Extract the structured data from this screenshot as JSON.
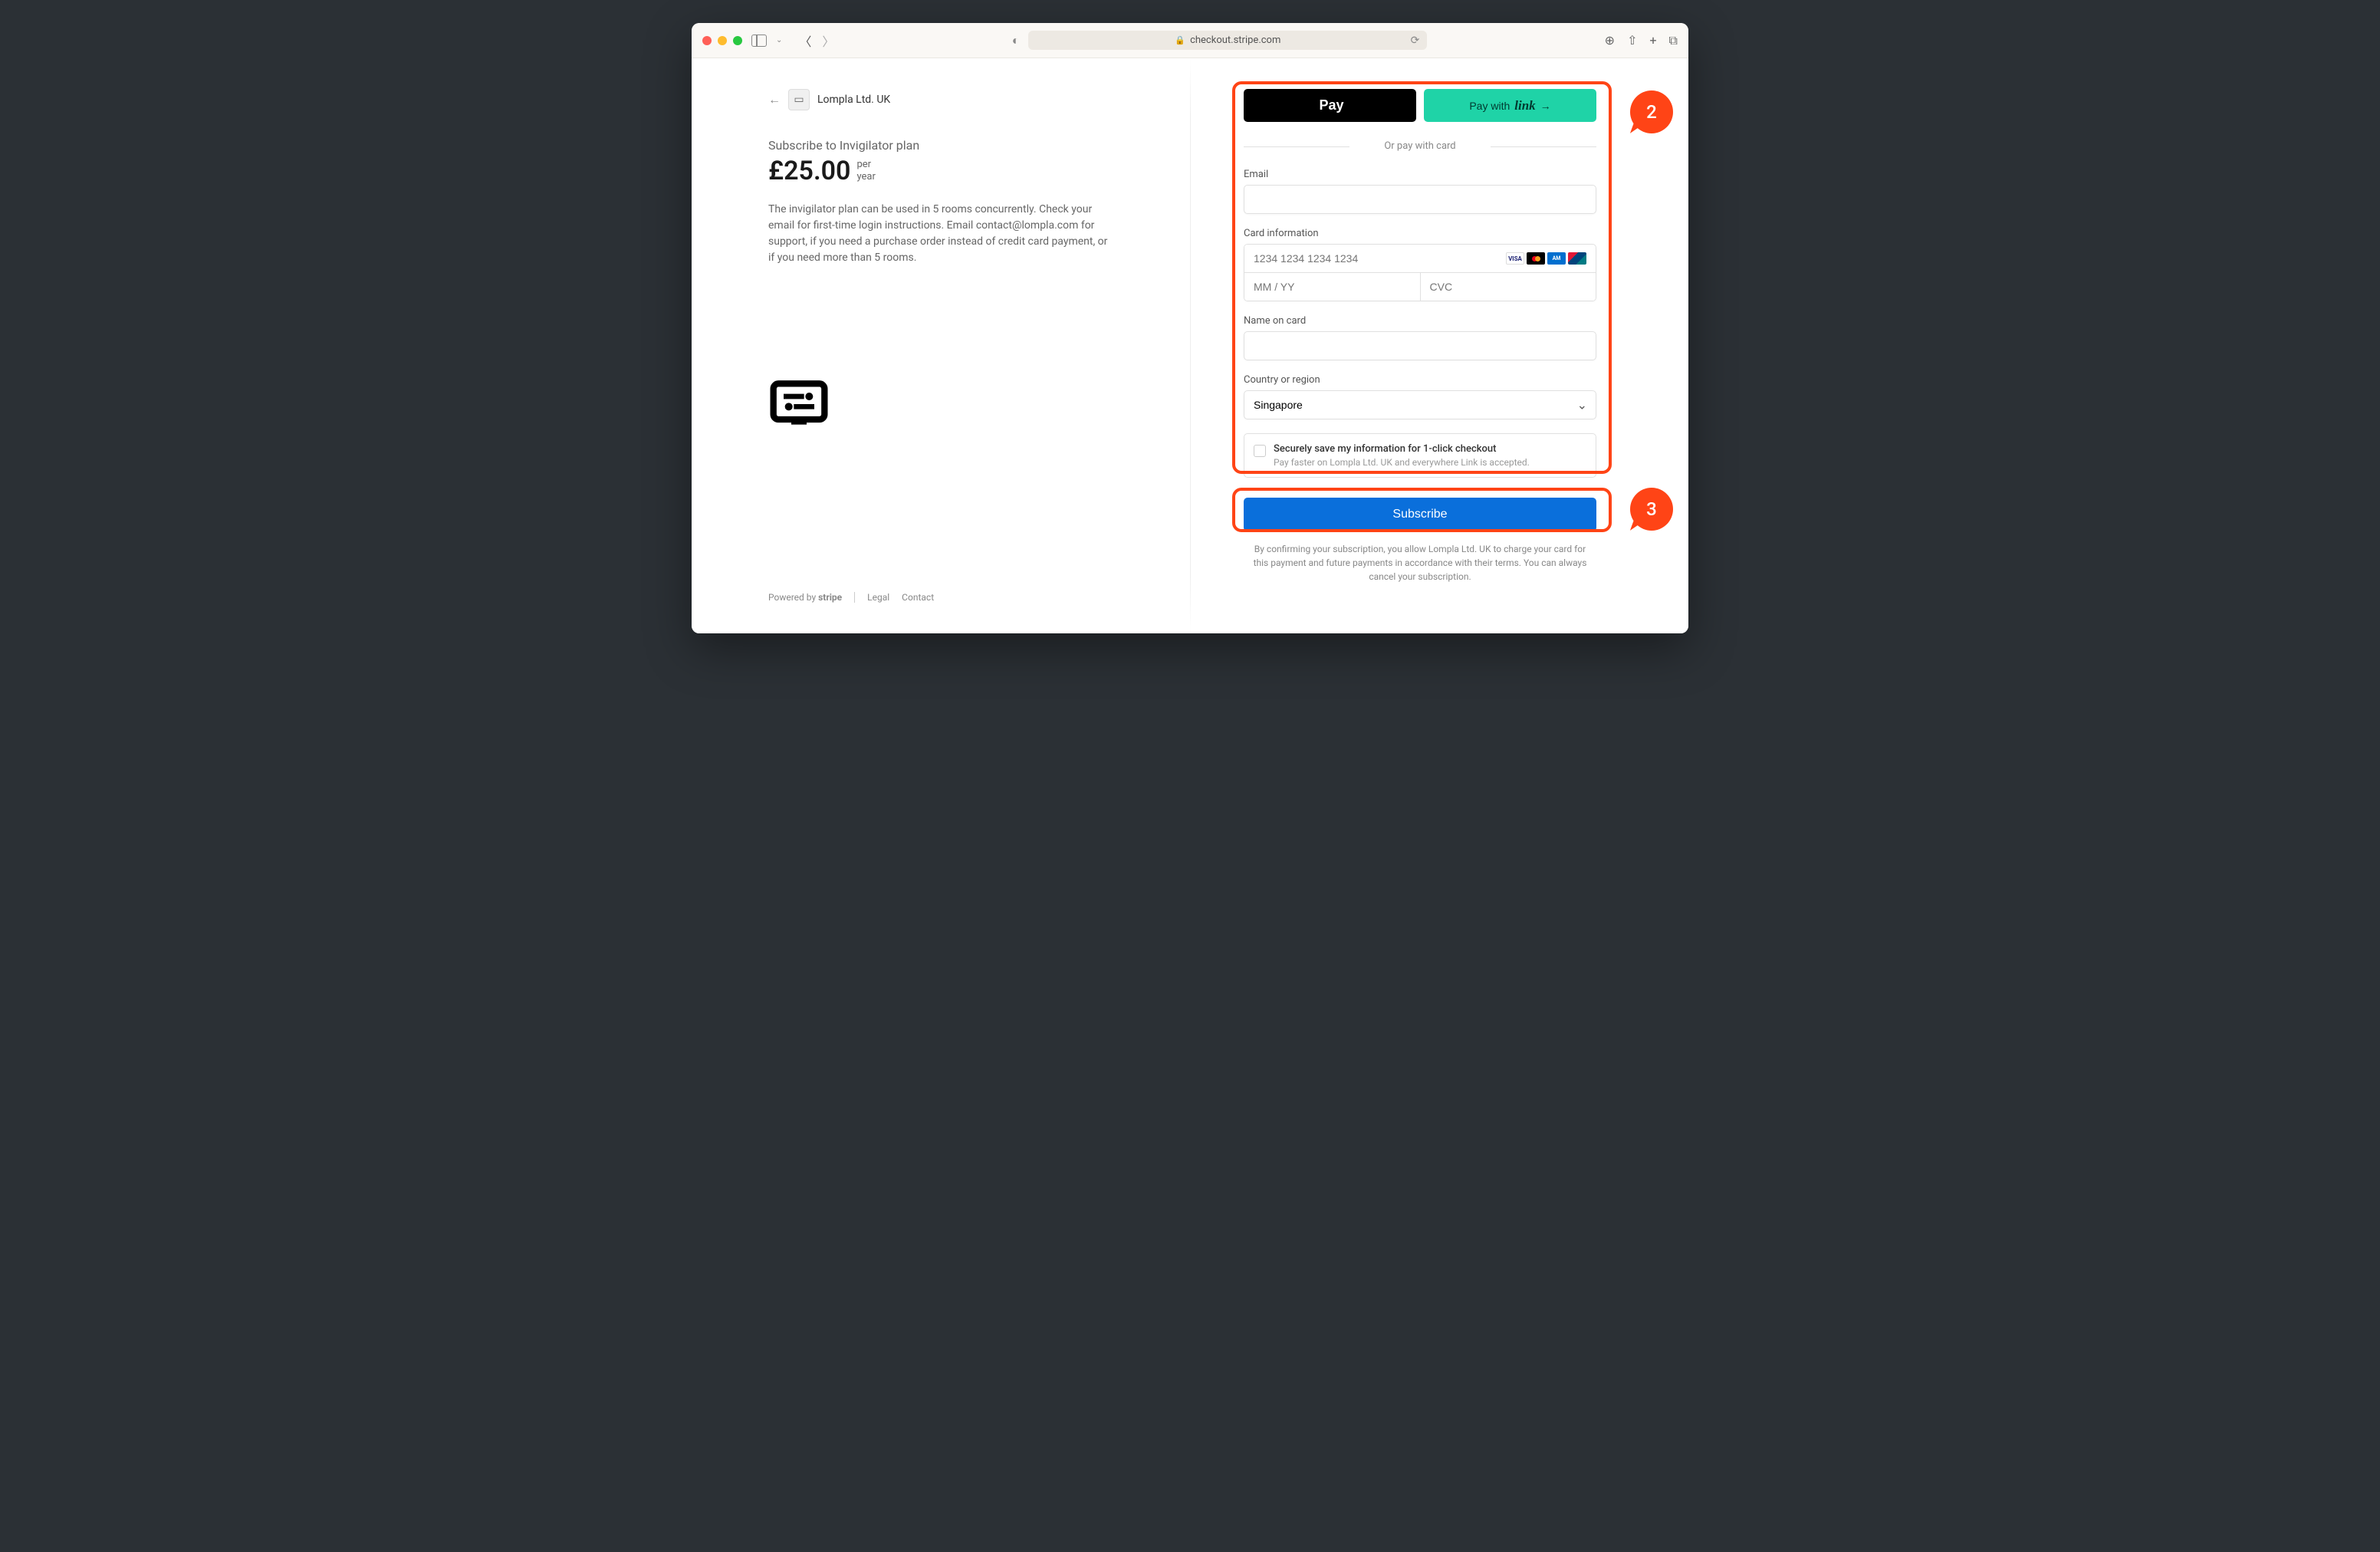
{
  "browser": {
    "url": "checkout.stripe.com"
  },
  "merchant": {
    "name": "Lompla Ltd. UK"
  },
  "product": {
    "subscribe_label": "Subscribe to Invigilator plan",
    "price": "£25.00",
    "period_line1": "per",
    "period_line2": "year",
    "description": "The invigilator plan can be used in 5 rooms concurrently. Check your email for first-time login instructions. Email contact@lompla.com for support, if you need a purchase order instead of credit card payment, or if you need more than 5 rooms."
  },
  "footer": {
    "powered": "Powered by",
    "brand": "stripe",
    "legal": "Legal",
    "contact": "Contact"
  },
  "pay": {
    "apple": "Pay",
    "link_prefix": "Pay with",
    "link_brand": "link",
    "divider": "Or pay with card"
  },
  "form": {
    "email_label": "Email",
    "card_label": "Card information",
    "card_placeholder": "1234 1234 1234 1234",
    "expiry_placeholder": "MM / YY",
    "cvc_placeholder": "CVC",
    "name_label": "Name on card",
    "country_label": "Country or region",
    "country_value": "Singapore",
    "save_title": "Securely save my information for 1-click checkout",
    "save_sub": "Pay faster on Lompla Ltd. UK and everywhere Link is accepted.",
    "subscribe": "Subscribe",
    "terms": "By confirming your subscription, you allow Lompla Ltd. UK to charge your card for this payment and future payments in accordance with their terms. You can always cancel your subscription."
  },
  "annotations": {
    "a1": "2",
    "a2": "3"
  }
}
